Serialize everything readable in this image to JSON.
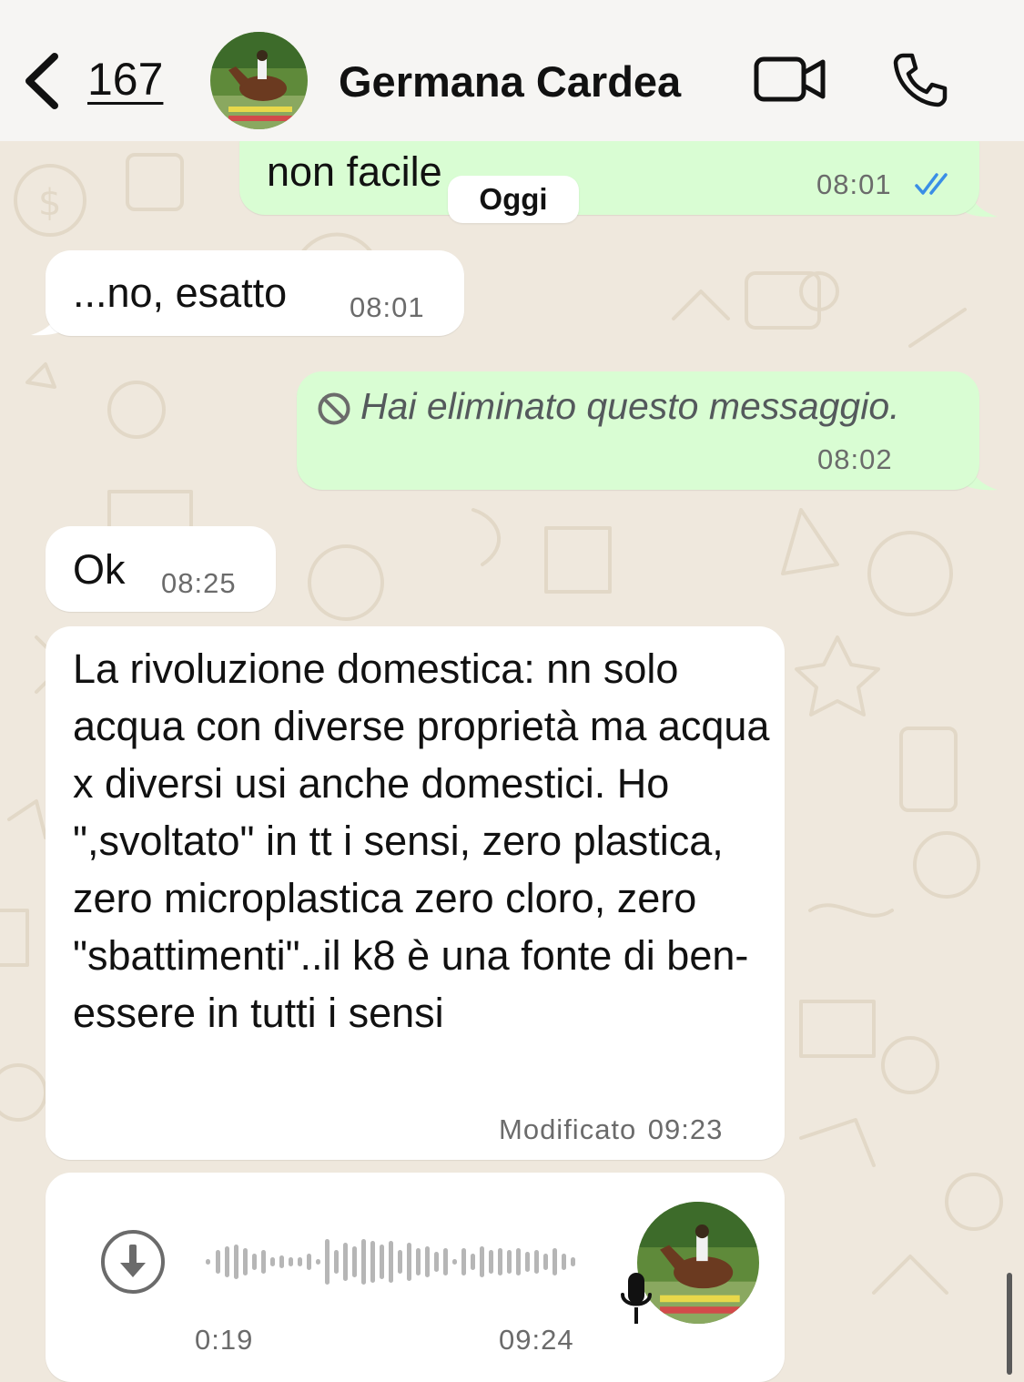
{
  "header": {
    "unread_count": "167",
    "contact_name": "Germana Cardea"
  },
  "date_divider": "Oggi",
  "messages": [
    {
      "direction": "outgoing",
      "text": "non facile",
      "time": "08:01",
      "status": "read"
    },
    {
      "direction": "incoming",
      "text": "...no, esatto",
      "time": "08:01"
    },
    {
      "direction": "outgoing",
      "text": "Hai eliminato questo messaggio.",
      "time": "08:02",
      "deleted": true
    },
    {
      "direction": "incoming",
      "text": "Ok",
      "time": "08:25"
    },
    {
      "direction": "incoming",
      "text": "La rivoluzione domestica: nn solo acqua con diverse proprietà ma acqua x diversi usi anche domestici. Ho \",svoltato\" in tt i sensi, zero plastica, zero microplastica zero cloro, zero \"sbattimenti\"..il k8 è una fonte di ben-essere in tutti i sensi",
      "edited_label": "Modificato",
      "time": "09:23"
    },
    {
      "direction": "incoming",
      "type": "voice",
      "duration": "0:19",
      "time": "09:24"
    }
  ],
  "colors": {
    "outgoing_bubble": "#d9fdd3",
    "incoming_bubble": "#ffffff",
    "background": "#efe8dd",
    "read_ticks": "#3a8ee6"
  },
  "icons": [
    "back-chevron-icon",
    "video-call-icon",
    "phone-call-icon",
    "deleted-message-icon",
    "read-ticks-icon",
    "download-icon",
    "microphone-icon"
  ]
}
